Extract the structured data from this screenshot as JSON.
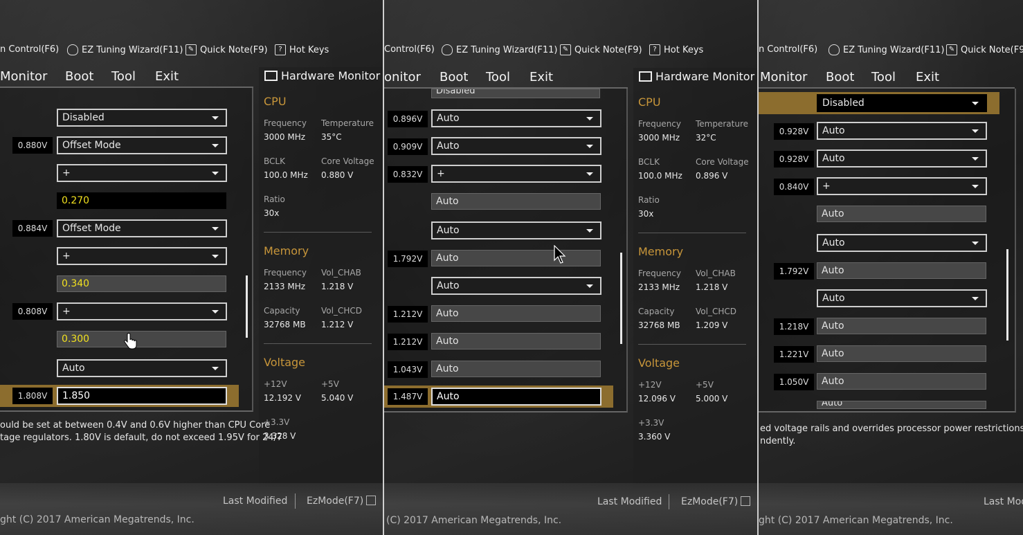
{
  "toolbar": {
    "fan_control": "n Control(F6)",
    "fan_control_2": "Control(F6)",
    "ez_tuning": "EZ Tuning Wizard(F11)",
    "quick_note": "Quick Note(F9)",
    "hot_keys": "Hot Keys"
  },
  "menu": {
    "monitor_1": "Monitor",
    "monitor_2": "onitor",
    "boot": "Boot",
    "tool": "Tool",
    "exit": "Exit"
  },
  "hardware_monitor": {
    "title": "Hardware Monitor",
    "cpu": {
      "heading": "CPU",
      "frequency_label": "Frequency",
      "frequency": "3000 MHz",
      "temperature_label": "Temperature",
      "bclk_label": "BCLK",
      "bclk": "100.0 MHz",
      "core_voltage_label": "Core Voltage",
      "ratio_label": "Ratio",
      "ratio": "30x"
    },
    "memory": {
      "heading": "Memory",
      "frequency_label": "Frequency",
      "frequency": "2133 MHz",
      "vol_chab_label": "Vol_CHAB",
      "vol_chab": "1.218 V",
      "capacity_label": "Capacity",
      "capacity": "32768 MB",
      "vol_chcd_label": "Vol_CHCD"
    },
    "voltage": {
      "heading": "Voltage",
      "v12_label": "+12V",
      "v5_label": "+5V",
      "v33_label": "+3.3V"
    },
    "panel1": {
      "temperature": "35°C",
      "core_voltage": "0.880 V",
      "vol_chcd": "1.212 V",
      "v12": "12.192 V",
      "v5": "5.040 V",
      "v33": "3.328 V"
    },
    "panel2": {
      "temperature": "32°C",
      "core_voltage": "0.896 V",
      "vol_chcd": "1.209 V",
      "v12": "12.096 V",
      "v5": "5.000 V",
      "v33": "3.360 V"
    }
  },
  "panel1": {
    "rows": [
      {
        "voltage": "",
        "value": "Disabled"
      },
      {
        "voltage": "0.880V",
        "value": "Offset Mode"
      },
      {
        "voltage": "",
        "value": "+"
      },
      {
        "voltage": "",
        "value": "0.270"
      },
      {
        "voltage": "0.884V",
        "value": "Offset Mode"
      },
      {
        "voltage": "",
        "value": "+"
      },
      {
        "voltage": "",
        "value": "0.340"
      },
      {
        "voltage": "0.808V",
        "value": "+"
      },
      {
        "voltage": "",
        "value": "0.300"
      },
      {
        "voltage": "",
        "value": "Auto"
      },
      {
        "voltage": "1.808V",
        "value": "1.850"
      }
    ],
    "help_line1": "ould be set at between 0.4V and 0.6V higher than CPU Core",
    "help_line2": "tage regulators. 1.80V is default, do not exceed 1.95V for 24/7"
  },
  "panel2": {
    "rows": [
      {
        "voltage": "",
        "value": "Disabled"
      },
      {
        "voltage": "0.896V",
        "value": "Auto"
      },
      {
        "voltage": "0.909V",
        "value": "Auto"
      },
      {
        "voltage": "0.832V",
        "value": "+"
      },
      {
        "voltage": "",
        "value": "Auto"
      },
      {
        "voltage": "",
        "value": "Auto"
      },
      {
        "voltage": "1.792V",
        "value": "Auto"
      },
      {
        "voltage": "",
        "value": "Auto"
      },
      {
        "voltage": "1.212V",
        "value": "Auto"
      },
      {
        "voltage": "1.212V",
        "value": "Auto"
      },
      {
        "voltage": "1.043V",
        "value": "Auto"
      },
      {
        "voltage": "1.487V",
        "value": "Auto"
      }
    ]
  },
  "panel3": {
    "rows": [
      {
        "voltage": "",
        "value": "Disabled"
      },
      {
        "voltage": "0.928V",
        "value": "Auto"
      },
      {
        "voltage": "0.928V",
        "value": "Auto"
      },
      {
        "voltage": "0.840V",
        "value": "+"
      },
      {
        "voltage": "",
        "value": "Auto"
      },
      {
        "voltage": "",
        "value": "Auto"
      },
      {
        "voltage": "1.792V",
        "value": "Auto"
      },
      {
        "voltage": "",
        "value": "Auto"
      },
      {
        "voltage": "1.218V",
        "value": "Auto"
      },
      {
        "voltage": "1.221V",
        "value": "Auto"
      },
      {
        "voltage": "1.050V",
        "value": "Auto"
      },
      {
        "voltage": "",
        "value": "Auto"
      }
    ],
    "help_line1": "ed voltage rails and overrides processor power restrictions;",
    "help_line2": "ndently."
  },
  "footer": {
    "last_modified": "Last Modified",
    "ezmode": "EzMode(F7)",
    "copyright_1": "ght (C) 2017 American Megatrends, Inc.",
    "copyright_2": "(C) 2017 American Megatrends, Inc.",
    "copyright_3": "ght (C) 2017 American Megatrends, Inc."
  },
  "colors": {
    "accent_gold": "#8c6d2e",
    "section_orange": "#c8963a",
    "yellow_value": "#f2e11f"
  }
}
